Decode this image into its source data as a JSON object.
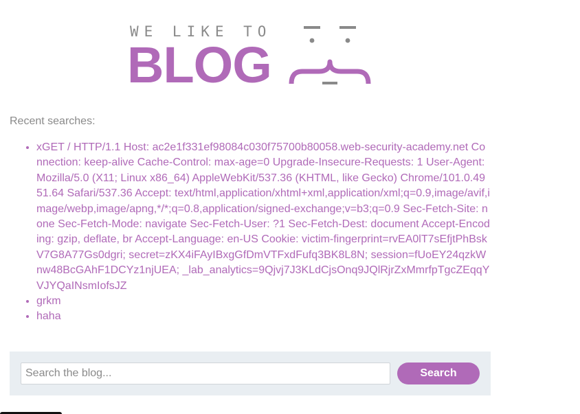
{
  "header": {
    "tagline": "WE LIKE TO",
    "wordmark": "BLOG",
    "brand_color": "#b06ab8",
    "mascot_icon": "curly-brace-face-icon"
  },
  "recent_searches": {
    "label": "Recent searches:",
    "items": [
      "xGET / HTTP/1.1 Host: ac2e1f331ef98084c030f75700b80058.web-security-academy.net Connection: keep-alive Cache-Control: max-age=0 Upgrade-Insecure-Requests: 1 User-Agent: Mozilla/5.0 (X11; Linux x86_64) AppleWebKit/537.36 (KHTML, like Gecko) Chrome/101.0.4951.64 Safari/537.36 Accept: text/html,application/xhtml+xml,application/xml;q=0.9,image/avif,image/webp,image/apng,*/*;q=0.8,application/signed-exchange;v=b3;q=0.9 Sec-Fetch-Site: none Sec-Fetch-Mode: navigate Sec-Fetch-User: ?1 Sec-Fetch-Dest: document Accept-Encoding: gzip, deflate, br Accept-Language: en-US Cookie: victim-fingerprint=rvEA0lT7sEfjtPhBskV7G8A77Gs0dgri; secret=zKX4iFAyIBxgGfDmVTFxdFufq3BK8L8N; session=fUoEY24qzkWnw48BcGAhF1DCYz1njUEA; _lab_analytics=9Qjvj7J3KLdCjsOnq9JQlRjrZxMmrfpTgcZEqqYVJYQaINsmIofsJZ",
      "grkm",
      "haha"
    ]
  },
  "search": {
    "placeholder": "Search the blog...",
    "value": "",
    "button_label": "Search"
  }
}
